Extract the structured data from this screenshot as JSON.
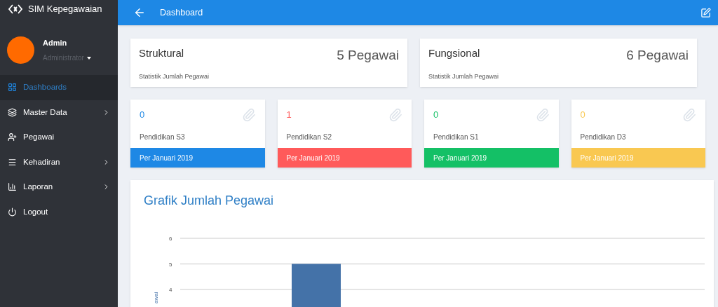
{
  "brand": {
    "title": "SIM Kepegawaian"
  },
  "user": {
    "name": "Admin",
    "role": "Administrator"
  },
  "sidebar": {
    "items": [
      {
        "label": "Dashboards",
        "selected": true,
        "has_submenu": false
      },
      {
        "label": "Master Data",
        "selected": false,
        "has_submenu": true
      },
      {
        "label": "Pegawai",
        "selected": false,
        "has_submenu": false
      },
      {
        "label": "Kehadiran",
        "selected": false,
        "has_submenu": true
      },
      {
        "label": "Laporan",
        "selected": false,
        "has_submenu": true
      },
      {
        "label": "Logout",
        "selected": false,
        "has_submenu": false
      }
    ]
  },
  "header": {
    "title": "Dashboard"
  },
  "summary_cards": [
    {
      "title": "Struktural",
      "value": "5 Pegawai",
      "subtitle": "Statistik Jumlah Pegawai"
    },
    {
      "title": "Fungsional",
      "value": "6 Pegawai",
      "subtitle": "Statistik Jumlah Pegawai"
    }
  ],
  "education_cards": [
    {
      "count": "0",
      "label": "Pendidikan S3",
      "footer": "Per Januari 2019",
      "color": "#1e88e5"
    },
    {
      "count": "1",
      "label": "Pendidikan S2",
      "footer": "Per Januari 2019",
      "color": "#ff5a5a"
    },
    {
      "count": "0",
      "label": "Pendidikan S1",
      "footer": "Per Januari 2019",
      "color": "#14c066"
    },
    {
      "count": "0",
      "label": "Pendidikan D3",
      "footer": "Per Januari 2019",
      "color": "#f9c851"
    }
  ],
  "chart_panel": {
    "title": "Grafik Jumlah Pegawai",
    "chart_data": {
      "type": "bar",
      "ylabel": "awai",
      "yticks": [
        4,
        5,
        6
      ],
      "ylim": [
        0,
        6
      ],
      "grid": true,
      "values": [
        5
      ]
    }
  }
}
